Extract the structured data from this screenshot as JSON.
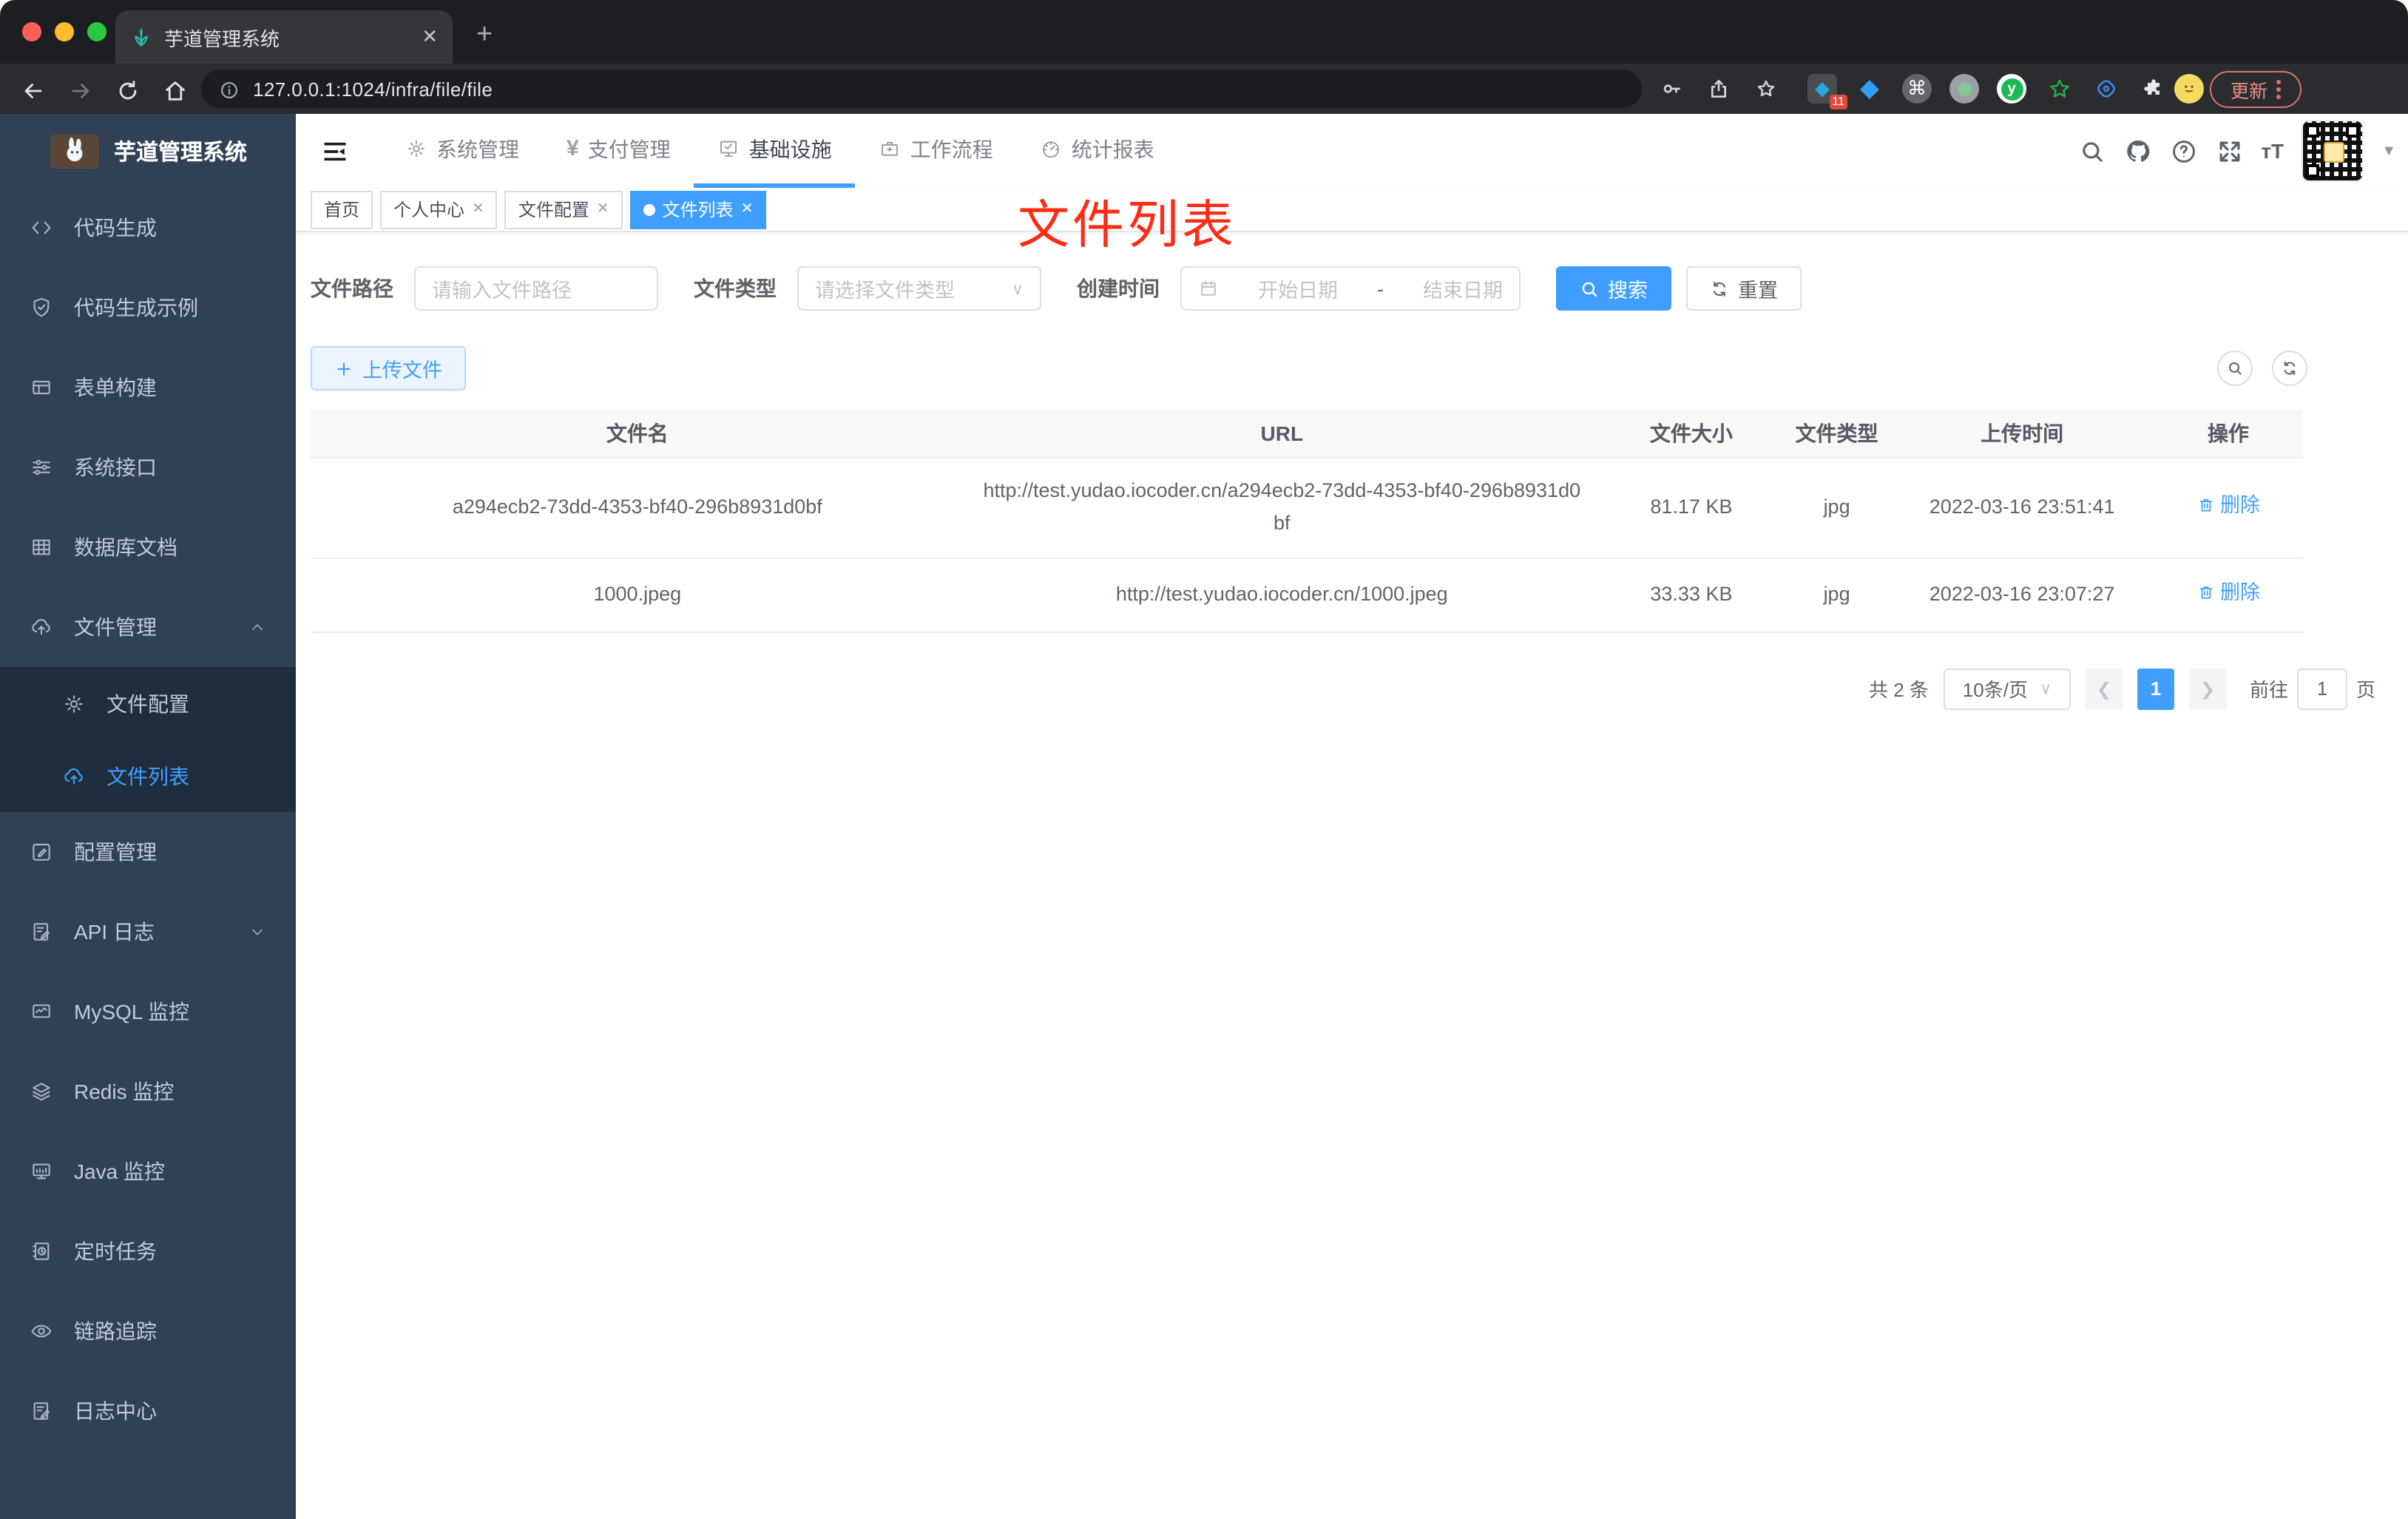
{
  "colors": {
    "primary": "#409eff",
    "annotation_red": "#fe2c15",
    "sidebar_bg": "#304156",
    "submenu_bg": "#1f2d3d",
    "traffic": [
      "#ff5f57",
      "#febc2e",
      "#28c840"
    ]
  },
  "browser": {
    "tab_title": "芋道管理系统",
    "url": "127.0.0.1:1024/infra/file/file",
    "extension_badge": "11",
    "update_label": "更新"
  },
  "sidebar": {
    "title": "芋道管理系统",
    "items": [
      {
        "icon": "code-icon",
        "label": "代码生成"
      },
      {
        "icon": "shield-check-icon",
        "label": "代码生成示例"
      },
      {
        "icon": "form-icon",
        "label": "表单构建"
      },
      {
        "icon": "sliders-icon",
        "label": "系统接口"
      },
      {
        "icon": "database-icon",
        "label": "数据库文档"
      },
      {
        "icon": "cloud-upload-icon",
        "label": "文件管理",
        "caret": "up",
        "children": [
          {
            "icon": "gear-icon",
            "label": "文件配置"
          },
          {
            "icon": "cloud-upload-icon",
            "label": "文件列表",
            "active": true
          }
        ]
      },
      {
        "icon": "edit-square-icon",
        "label": "配置管理"
      },
      {
        "icon": "doc-edit-icon",
        "label": "API 日志",
        "caret": "down"
      },
      {
        "icon": "chart-monitor-icon",
        "label": "MySQL 监控"
      },
      {
        "icon": "layers-icon",
        "label": "Redis 监控"
      },
      {
        "icon": "monitor-icon",
        "label": "Java 监控"
      },
      {
        "icon": "schedule-icon",
        "label": "定时任务"
      },
      {
        "icon": "eye-icon",
        "label": "链路追踪"
      },
      {
        "icon": "doc-edit-icon",
        "label": "日志中心"
      }
    ]
  },
  "topnav": [
    {
      "icon": "gear-icon",
      "label": "系统管理"
    },
    {
      "icon": "yen-icon",
      "label": "支付管理"
    },
    {
      "icon": "infra-icon",
      "label": "基础设施",
      "active": true
    },
    {
      "icon": "workflow-icon",
      "label": "工作流程"
    },
    {
      "icon": "report-icon",
      "label": "统计报表"
    }
  ],
  "tags": [
    {
      "label": "首页",
      "closable": false
    },
    {
      "label": "个人中心",
      "closable": true
    },
    {
      "label": "文件配置",
      "closable": true
    },
    {
      "label": "文件列表",
      "closable": true,
      "active": true
    }
  ],
  "annotation": "文件列表",
  "filters": {
    "path_label": "文件路径",
    "path_placeholder": "请输入文件路径",
    "type_label": "文件类型",
    "type_placeholder": "请选择文件类型",
    "time_label": "创建时间",
    "start_placeholder": "开始日期",
    "separator": "-",
    "end_placeholder": "结束日期",
    "search_label": "搜索",
    "reset_label": "重置"
  },
  "toolbar": {
    "upload_label": "上传文件"
  },
  "table": {
    "columns": [
      "文件名",
      "URL",
      "文件大小",
      "文件类型",
      "上传时间",
      "操作"
    ],
    "delete_label": "删除",
    "rows": [
      {
        "name": "a294ecb2-73dd-4353-bf40-296b8931d0bf",
        "url": "http://test.yudao.iocoder.cn/a294ecb2-73dd-4353-bf40-296b8931d0bf",
        "size": "81.17 KB",
        "type": "jpg",
        "time": "2022-03-16 23:51:41"
      },
      {
        "name": "1000.jpeg",
        "url": "http://test.yudao.iocoder.cn/1000.jpeg",
        "size": "33.33 KB",
        "type": "jpg",
        "time": "2022-03-16 23:07:27"
      }
    ]
  },
  "pagination": {
    "total": "共 2 条",
    "page_size": "10条/页",
    "current_page": "1",
    "goto_prefix": "前往",
    "goto_value": "1",
    "goto_suffix": "页"
  }
}
